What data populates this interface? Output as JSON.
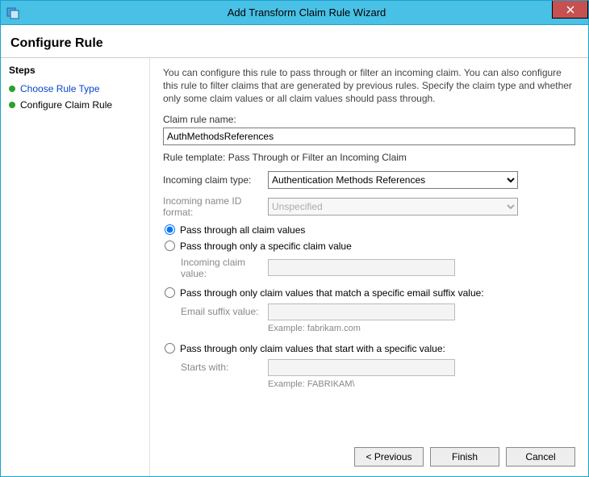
{
  "window": {
    "title": "Add Transform Claim Rule Wizard"
  },
  "header": {
    "title": "Configure Rule"
  },
  "sidebar": {
    "title": "Steps",
    "items": [
      {
        "label": "Choose Rule Type",
        "current": false
      },
      {
        "label": "Configure Claim Rule",
        "current": true
      }
    ]
  },
  "main": {
    "intro": "You can configure this rule to pass through or filter an incoming claim. You can also configure this rule to filter claims that are generated by previous rules. Specify the claim type and whether only some claim values or all claim values should pass through.",
    "ruleName": {
      "label": "Claim rule name:",
      "value": "AuthMethodsReferences"
    },
    "template": "Rule template: Pass Through or Filter an Incoming Claim",
    "claimType": {
      "label": "Incoming claim type:",
      "value": "Authentication Methods References"
    },
    "nameIdFormat": {
      "label": "Incoming name ID format:",
      "value": "Unspecified"
    },
    "options": {
      "all": "Pass through all claim values",
      "specific": "Pass through only a specific claim value",
      "specificLabel": "Incoming claim value:",
      "email": "Pass through only claim values that match a specific email suffix value:",
      "emailLabel": "Email suffix value:",
      "emailExample": "Example: fabrikam.com",
      "starts": "Pass through only claim values that start with a specific value:",
      "startsLabel": "Starts with:",
      "startsExample": "Example: FABRIKAM\\"
    }
  },
  "footer": {
    "previous": "< Previous",
    "finish": "Finish",
    "cancel": "Cancel"
  }
}
